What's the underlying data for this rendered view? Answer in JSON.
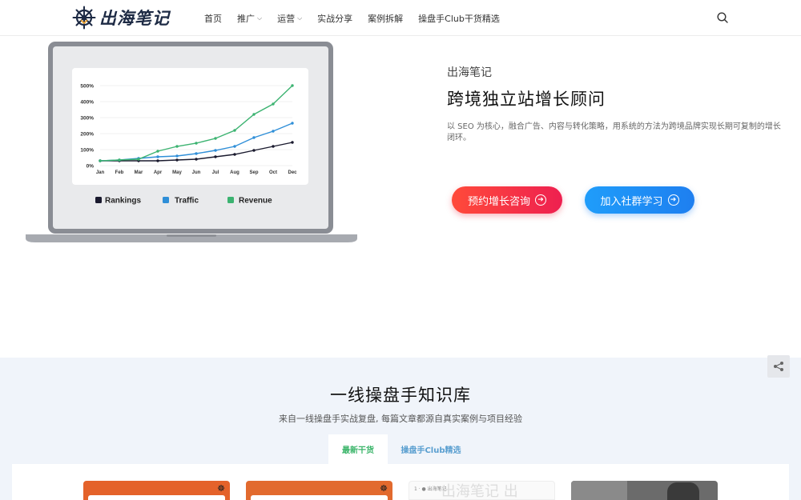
{
  "header": {
    "logo_text": "出海笔记",
    "nav": [
      {
        "label": "首页",
        "has_dropdown": false
      },
      {
        "label": "推广",
        "has_dropdown": true
      },
      {
        "label": "运营",
        "has_dropdown": true
      },
      {
        "label": "实战分享",
        "has_dropdown": false
      },
      {
        "label": "案例拆解",
        "has_dropdown": false
      },
      {
        "label": "操盘手Club干货精选",
        "has_dropdown": false
      }
    ],
    "search_icon": "search-icon"
  },
  "hero": {
    "brand": "出海笔记",
    "title": "跨境独立站增长顾问",
    "description": "以 SEO 为核心，融合广告、内容与转化策略，用系统的方法为跨境品牌实现长期可复制的增长闭环。",
    "primary_button": "预约增长咨询",
    "secondary_button": "加入社群学习",
    "colors": {
      "primary": "#f0334a",
      "secondary": "#1e8ef5"
    }
  },
  "chart_data": {
    "type": "line",
    "categories": [
      "Jan",
      "Feb",
      "Mar",
      "Apr",
      "May",
      "Jun",
      "Jul",
      "Aug",
      "Sep",
      "Oct",
      "Dec"
    ],
    "ylim": [
      0,
      500
    ],
    "yticks": [
      "0%",
      "100%",
      "200%",
      "300%",
      "400%",
      "500%"
    ],
    "grid": true,
    "legend_position": "bottom",
    "series": [
      {
        "name": "Rankings",
        "color": "#1a1a2e",
        "values": [
          30,
          30,
          30,
          30,
          35,
          40,
          55,
          70,
          95,
          120,
          145
        ]
      },
      {
        "name": "Traffic",
        "color": "#2f8fd8",
        "values": [
          30,
          35,
          45,
          55,
          60,
          75,
          95,
          120,
          175,
          215,
          265
        ]
      },
      {
        "name": "Revenue",
        "color": "#3cb371",
        "values": [
          30,
          35,
          40,
          90,
          120,
          140,
          170,
          220,
          320,
          385,
          500
        ]
      }
    ]
  },
  "knowledge": {
    "title": "一线操盘手知识库",
    "subtitle": "来自一线操盘手实战复盘, 每篇文章都源自真实案例与项目经验",
    "tabs": [
      "最新干货",
      "操盘手Club精选"
    ],
    "card3_top": "1 · ● 出海笔记",
    "card3_watermark": "出海笔记 出"
  }
}
